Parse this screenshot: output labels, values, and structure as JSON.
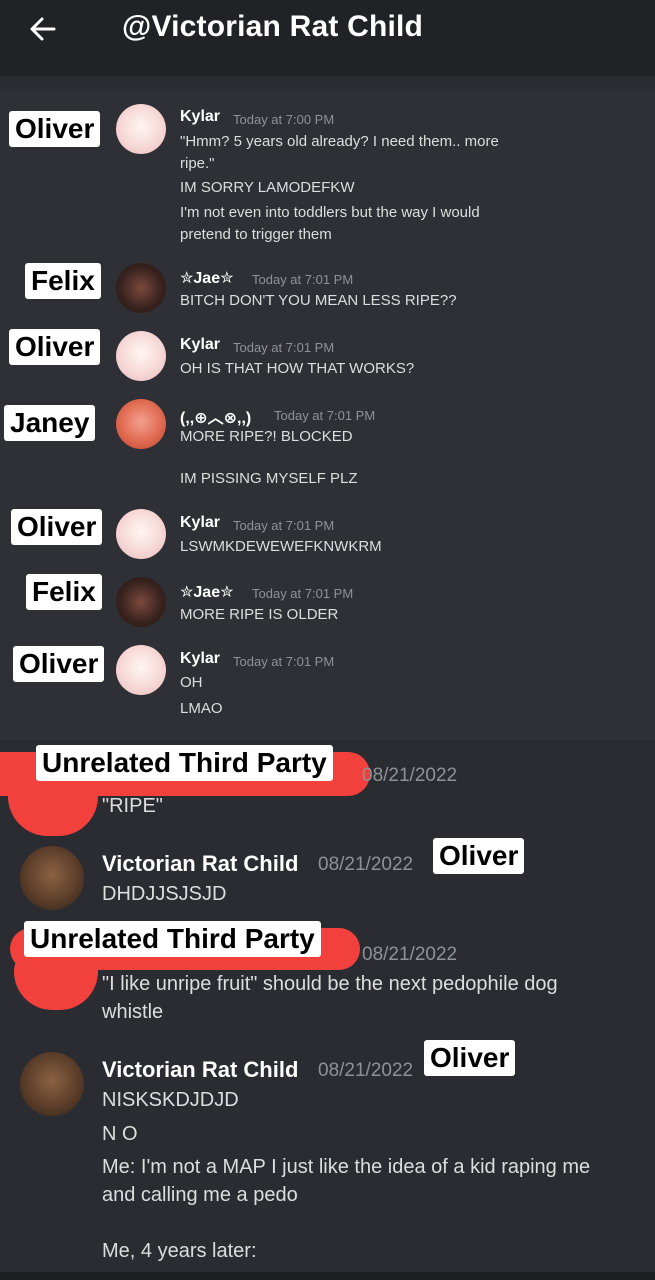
{
  "topbar": {
    "title": "@Victorian Rat Child"
  },
  "messages": [
    {
      "label": "Oliver",
      "author": "Kylar",
      "time": "Today at 7:00 PM",
      "lines": [
        "\"Hmm? 5 years old already? I need them.. more",
        "ripe.\"",
        "IM SORRY LAMODEFKW",
        "I'm not even into toddlers but the way I would",
        "pretend to trigger them"
      ]
    },
    {
      "label": "Felix",
      "author": "✮Jae✮",
      "time": "Today at 7:01 PM",
      "lines": [
        "BITCH DON'T YOU MEAN LESS RIPE??"
      ]
    },
    {
      "label": "Oliver",
      "author": "Kylar",
      "time": "Today at 7:01 PM",
      "lines": [
        "OH IS THAT HOW THAT WORKS?"
      ]
    },
    {
      "label": "Janey",
      "author": "(,,⊕︿⊗,,)",
      "time": "Today at 7:01 PM",
      "lines": [
        "MORE RIPE?! BLOCKED",
        "IM PISSING MYSELF PLZ"
      ]
    },
    {
      "label": "Oliver",
      "author": "Kylar",
      "time": "Today at 7:01 PM",
      "lines": [
        "LSWMKDEWEWEFKNWKRM"
      ]
    },
    {
      "label": "Felix",
      "author": "✮Jae✮",
      "time": "Today at 7:01 PM",
      "lines": [
        "MORE RIPE IS OLDER"
      ]
    },
    {
      "label": "Oliver",
      "author": "Kylar",
      "time": "Today at 7:01 PM",
      "lines": [
        "OH",
        "LMAO"
      ]
    },
    {
      "label": "Unrelated Third Party",
      "author": "",
      "time": "08/21/2022",
      "lines": [
        "\"RIPE\""
      ]
    },
    {
      "label": "Oliver",
      "author": "Victorian Rat Child",
      "time": "08/21/2022",
      "lines": [
        "DHDJJSJSJD"
      ]
    },
    {
      "label": "Unrelated Third Party",
      "author": "",
      "time": "08/21/2022",
      "lines": [
        "\"I like unripe fruit\" should be the next pedophile dog",
        "whistle"
      ]
    },
    {
      "label": "Oliver",
      "author": "Victorian Rat Child",
      "time": "08/21/2022",
      "lines": [
        "NISKSKDJDJD",
        "N O",
        "Me: I'm not a MAP I just like the idea of a kid raping me",
        "and calling me a pedo",
        "Me, 4 years later:"
      ]
    }
  ]
}
